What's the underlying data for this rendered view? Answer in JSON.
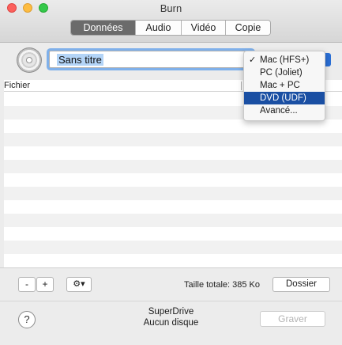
{
  "window": {
    "title": "Burn"
  },
  "tabs": [
    {
      "label": "Données",
      "active": true
    },
    {
      "label": "Audio",
      "active": false
    },
    {
      "label": "Vidéo",
      "active": false
    },
    {
      "label": "Copie",
      "active": false
    }
  ],
  "disc": {
    "icon": "disc-icon",
    "name_value": "Sans titre"
  },
  "format_menu": {
    "items": [
      {
        "label": "Mac (HFS+)",
        "checked": true,
        "highlighted": false
      },
      {
        "label": "PC (Joliet)",
        "checked": false,
        "highlighted": false
      },
      {
        "label": "Mac + PC",
        "checked": false,
        "highlighted": false
      },
      {
        "label": "DVD (UDF)",
        "checked": false,
        "highlighted": true
      },
      {
        "label": "Avancé...",
        "checked": false,
        "highlighted": false
      }
    ],
    "check_glyph": "✓"
  },
  "table": {
    "columns": [
      "Fichier"
    ],
    "rows": []
  },
  "toolbar": {
    "minus_label": "-",
    "plus_label": "+",
    "gear_icon": "gear-icon",
    "total_label": "Taille totale: 385 Ko",
    "folder_label": "Dossier"
  },
  "status": {
    "help_label": "?",
    "drive_name": "SuperDrive",
    "drive_status": "Aucun disque",
    "burn_label": "Graver"
  },
  "colors": {
    "accent": "#1a4fa3",
    "selection": "#b3d4f7",
    "focus_ring": "#7fb0ea"
  }
}
